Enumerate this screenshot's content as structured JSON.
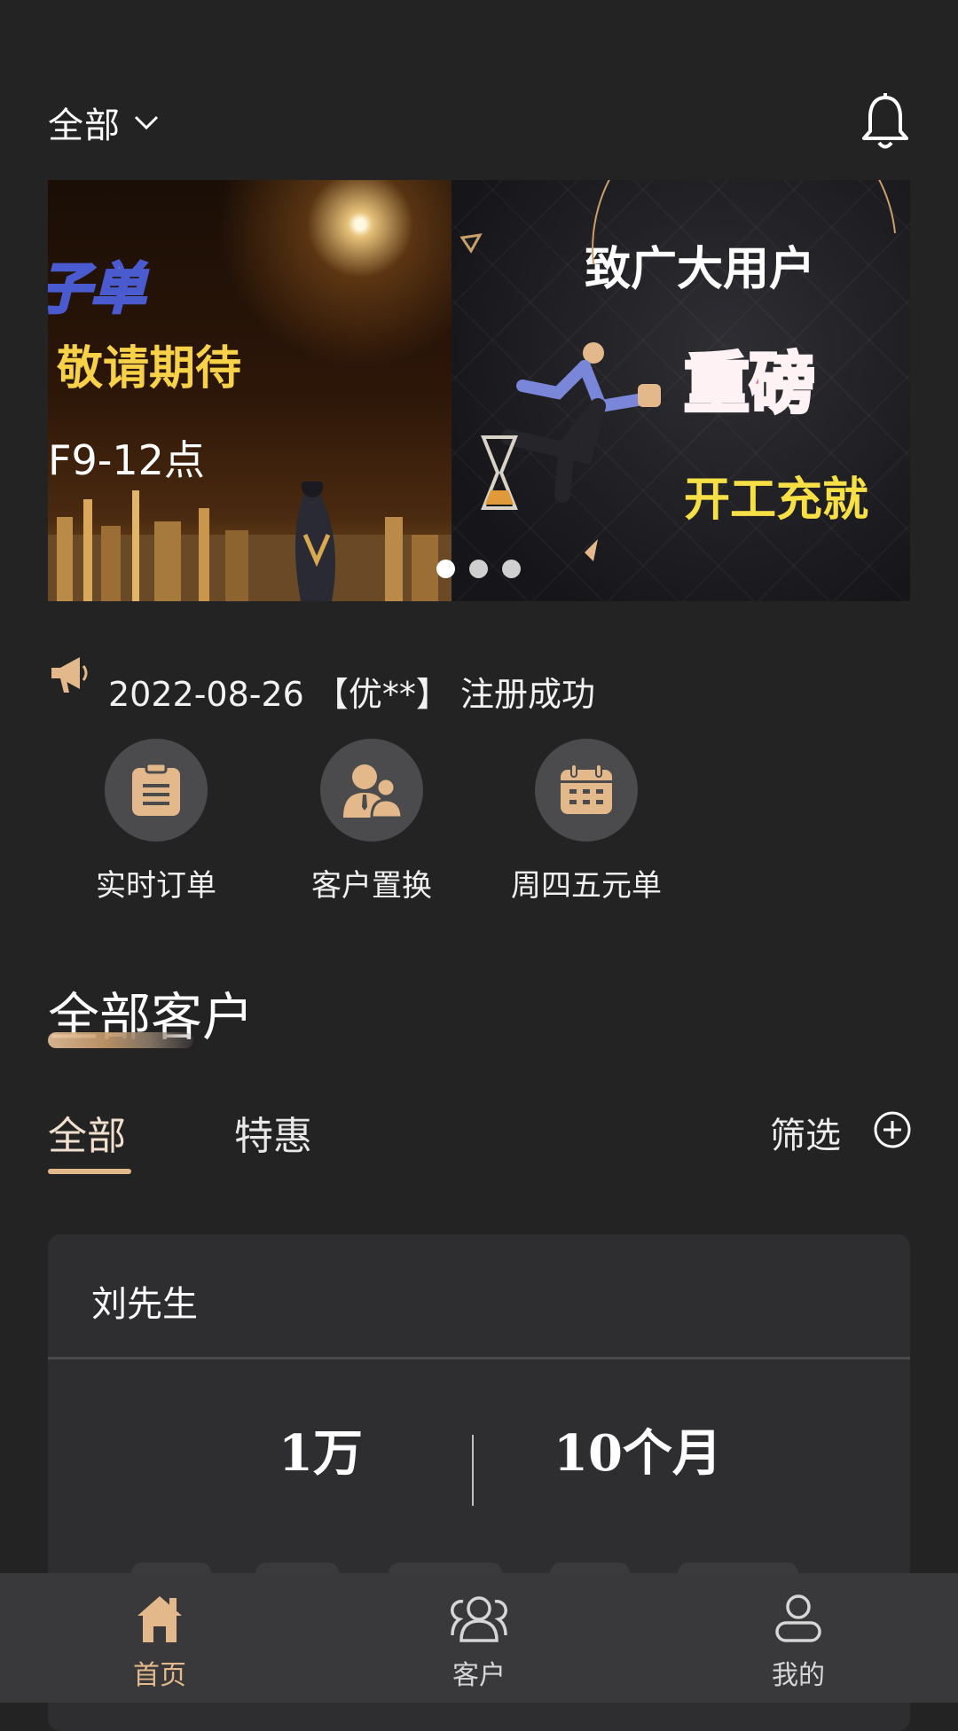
{
  "header": {
    "region_label": "全部"
  },
  "banner": {
    "left_slide": {
      "line1": "子单",
      "line2": "敬请期待",
      "line3": "F9-12点"
    },
    "right_slide": {
      "line1": "致广大用户",
      "line2": "重磅",
      "line3": "开工充就"
    },
    "dots_count": 3,
    "active_dot": 1
  },
  "notice": {
    "text": "2022-08-26 【优**】 注册成功"
  },
  "quick_entries": [
    {
      "label": "实时订单",
      "icon": "clipboard-icon"
    },
    {
      "label": "客户置换",
      "icon": "people-icon"
    },
    {
      "label": "周四五元单",
      "icon": "calendar-icon"
    }
  ],
  "section": {
    "title": "全部客户"
  },
  "tabs": [
    {
      "label": "全部",
      "active": true
    },
    {
      "label": "特惠",
      "active": false
    }
  ],
  "filter": {
    "label": "筛选"
  },
  "card": {
    "name": "刘先生",
    "amount": "1万",
    "term": "10个月"
  },
  "bottom_nav": [
    {
      "label": "首页",
      "icon": "home-icon",
      "active": true
    },
    {
      "label": "客户",
      "icon": "customers-icon",
      "active": false
    },
    {
      "label": "我的",
      "icon": "user-icon",
      "active": false
    }
  ],
  "colors": {
    "background": "#232324",
    "accent": "#e3b98b",
    "card": "#2e2e30",
    "nav": "#39393b"
  }
}
